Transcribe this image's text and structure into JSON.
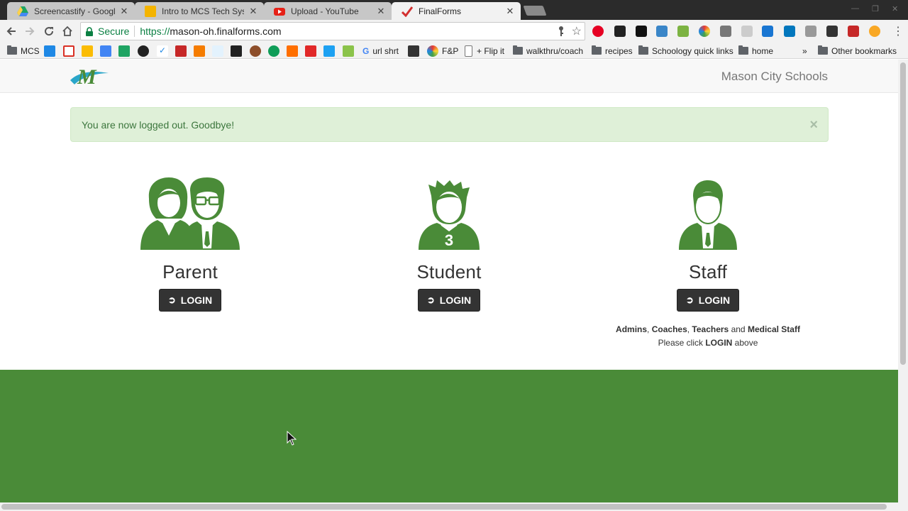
{
  "browser": {
    "tabs": [
      {
        "title": "Screencastify - Google Dri",
        "favicon_color": "#1fa463"
      },
      {
        "title": "Intro to MCS Tech Syster",
        "favicon_color": "#f4b400"
      },
      {
        "title": "Upload - YouTube",
        "favicon_color": "#e62117"
      },
      {
        "title": "FinalForms",
        "favicon_color": "#d32f2f"
      }
    ],
    "address": {
      "secure_label": "Secure",
      "scheme": "https://",
      "host": "mason-oh.finalforms.com"
    },
    "bookmarks": {
      "mcs": "MCS",
      "url_shrt": "url shrt",
      "fp": "F&P",
      "flip_it": "+ Flip it",
      "walkthru": "walkthru/coach",
      "recipes": "recipes",
      "schoology": "Schoology quick links",
      "home": "home",
      "overflow": "»",
      "other": "Other bookmarks"
    }
  },
  "site": {
    "brand_name": "Mason City Schools",
    "logo_letter": "M",
    "alert": {
      "message": "You are now logged out. Goodbye!",
      "close": "×"
    },
    "parent": {
      "title": "Parent",
      "login": "LOGIN"
    },
    "student": {
      "title": "Student",
      "login": "LOGIN",
      "jersey_number": "3"
    },
    "staff": {
      "title": "Staff",
      "login": "LOGIN",
      "note": {
        "admins": "Admins",
        "coaches": "Coaches",
        "teachers": "Teachers",
        "and": "and",
        "medical": "Medical Staff",
        "please_click": "Please click",
        "login": "LOGIN",
        "above": "above"
      }
    },
    "colors": {
      "brand_green": "#4a8b38",
      "alert_bg": "#dff0d8",
      "alert_text": "#3c763d"
    }
  }
}
